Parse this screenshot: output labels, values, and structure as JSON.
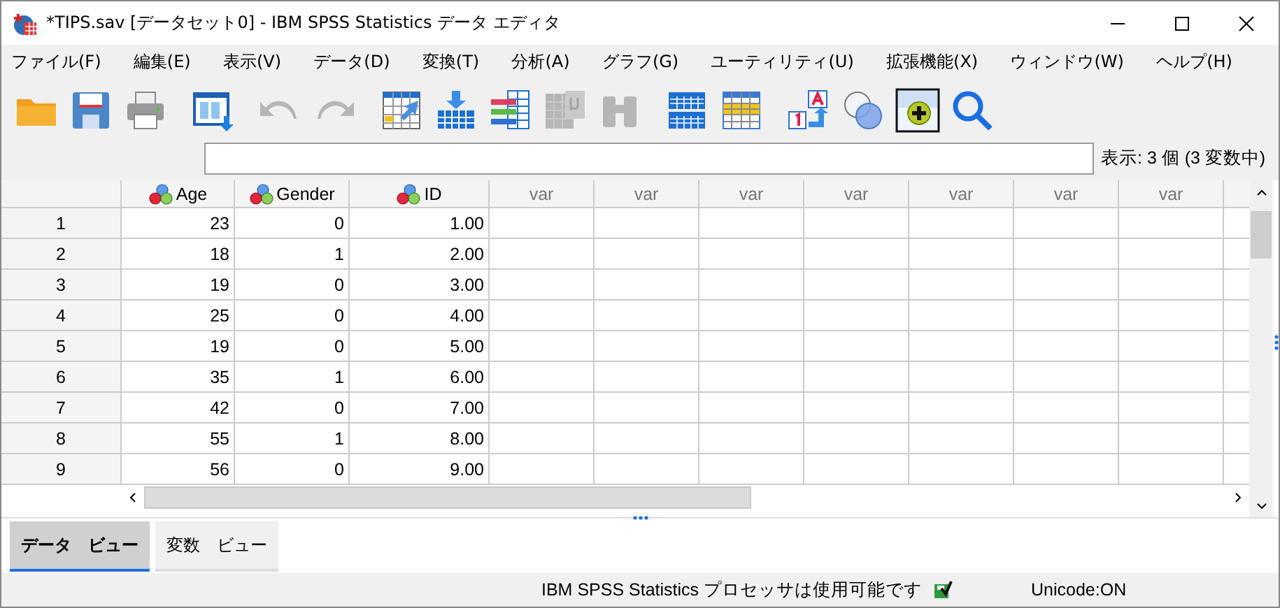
{
  "window": {
    "title": "*TIPS.sav [データセット0] - IBM SPSS Statistics データ エディタ"
  },
  "menu": [
    "ファイル(F)",
    "編集(E)",
    "表示(V)",
    "データ(D)",
    "変換(T)",
    "分析(A)",
    "グラフ(G)",
    "ユーティリティ(U)",
    "拡張機能(X)",
    "ウィンドウ(W)",
    "ヘルプ(H)"
  ],
  "toolbar": [
    {
      "kind": "open",
      "disabled": false
    },
    {
      "kind": "save",
      "disabled": false
    },
    {
      "kind": "print",
      "disabled": false
    },
    {
      "kind": "dialog",
      "disabled": false
    },
    {
      "kind": "undo",
      "disabled": true
    },
    {
      "kind": "redo",
      "disabled": true
    },
    {
      "kind": "gotocase",
      "disabled": false
    },
    {
      "kind": "insertcase",
      "disabled": false
    },
    {
      "kind": "variables",
      "disabled": false
    },
    {
      "kind": "gridmu",
      "disabled": true
    },
    {
      "kind": "find",
      "disabled": true
    },
    {
      "kind": "split",
      "disabled": false
    },
    {
      "kind": "select",
      "disabled": false
    },
    {
      "kind": "labels",
      "disabled": false
    },
    {
      "kind": "sets",
      "disabled": false
    },
    {
      "kind": "addon",
      "disabled": false
    },
    {
      "kind": "search",
      "disabled": false
    }
  ],
  "visible_info": "表示: 3 個 (3 変数中)",
  "table": {
    "columns": [
      {
        "name": "Age",
        "kind": "variable"
      },
      {
        "name": "Gender",
        "kind": "variable"
      },
      {
        "name": "ID",
        "kind": "variable"
      },
      {
        "name": "var",
        "kind": "empty"
      },
      {
        "name": "var",
        "kind": "empty"
      },
      {
        "name": "var",
        "kind": "empty"
      },
      {
        "name": "var",
        "kind": "empty"
      },
      {
        "name": "var",
        "kind": "empty"
      },
      {
        "name": "var",
        "kind": "empty"
      },
      {
        "name": "var",
        "kind": "empty"
      }
    ],
    "rows": [
      {
        "case": "1",
        "values": [
          "23",
          "0",
          "1.00"
        ]
      },
      {
        "case": "2",
        "values": [
          "18",
          "1",
          "2.00"
        ]
      },
      {
        "case": "3",
        "values": [
          "19",
          "0",
          "3.00"
        ]
      },
      {
        "case": "4",
        "values": [
          "25",
          "0",
          "4.00"
        ]
      },
      {
        "case": "5",
        "values": [
          "19",
          "0",
          "5.00"
        ]
      },
      {
        "case": "6",
        "values": [
          "35",
          "1",
          "6.00"
        ]
      },
      {
        "case": "7",
        "values": [
          "42",
          "0",
          "7.00"
        ]
      },
      {
        "case": "8",
        "values": [
          "55",
          "1",
          "8.00"
        ]
      },
      {
        "case": "9",
        "values": [
          "56",
          "0",
          "9.00"
        ]
      }
    ]
  },
  "tabs": [
    {
      "label": "データ　ビュー",
      "selected": true
    },
    {
      "label": "変数　ビュー",
      "selected": false
    }
  ],
  "status_bar": {
    "message": "IBM SPSS Statistics プロセッサは使用可能です",
    "encoding": "Unicode:ON"
  }
}
